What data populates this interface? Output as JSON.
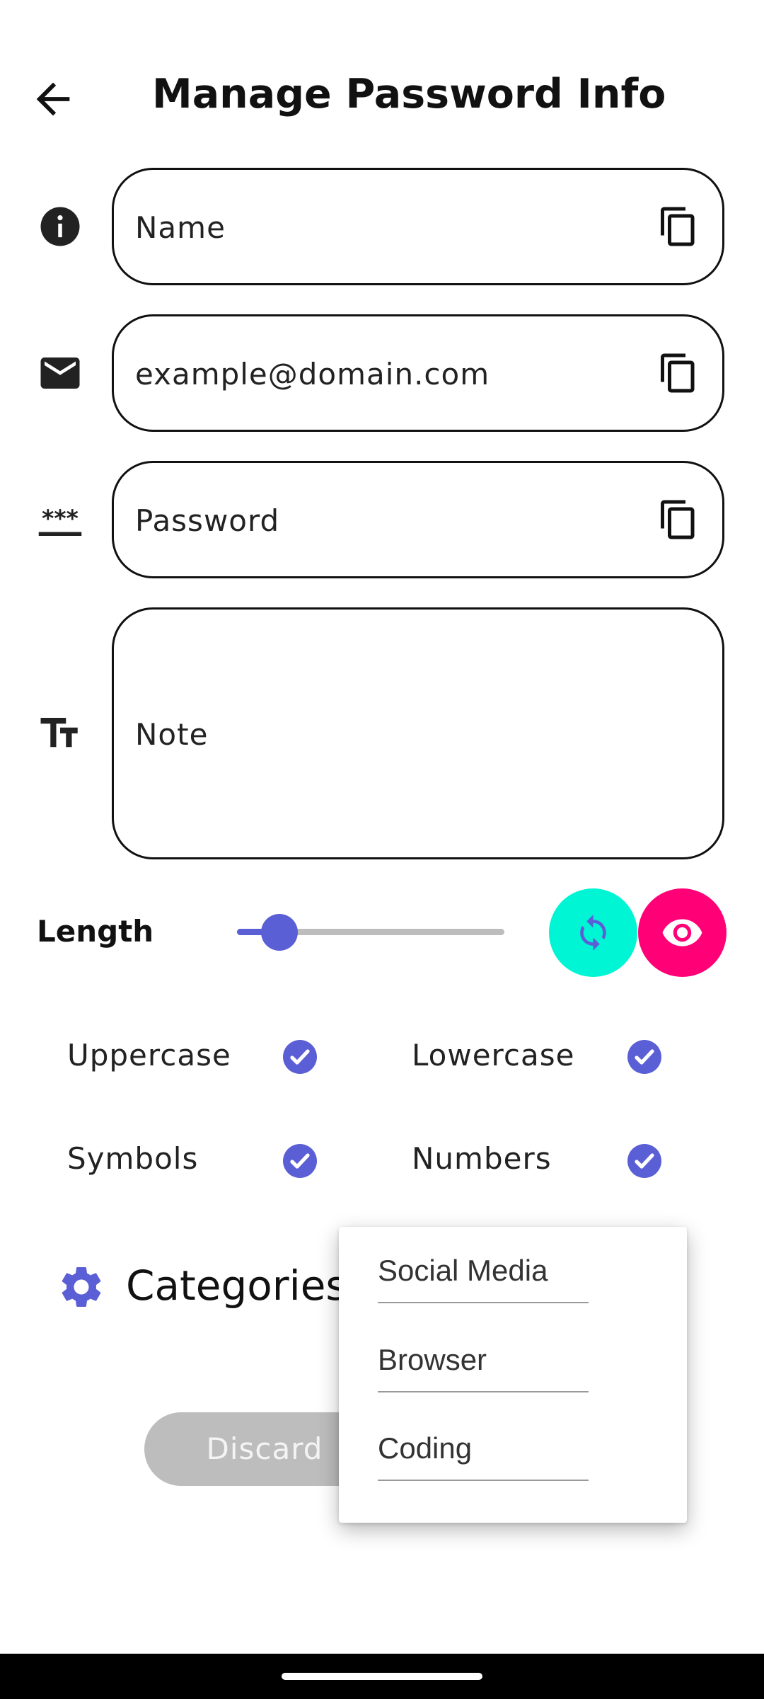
{
  "header": {
    "title": "Manage Password Info",
    "back_icon": "arrow-back-icon"
  },
  "fields": {
    "name": {
      "placeholder": "Name",
      "icon": "info-icon",
      "action_icon": "copy-icon"
    },
    "email": {
      "placeholder": "example@domain.com",
      "icon": "mail-icon",
      "action_icon": "copy-icon"
    },
    "password": {
      "placeholder": "Password",
      "icon": "password-icon",
      "action_icon": "copy-icon"
    },
    "note": {
      "placeholder": "Note",
      "icon": "text-size-icon"
    }
  },
  "generator": {
    "length_label": "Length",
    "length_slider_fraction": 0.16,
    "refresh_icon": "refresh-icon",
    "visibility_icon": "eye-icon",
    "options": [
      {
        "label": "Uppercase",
        "checked": true
      },
      {
        "label": "Lowercase",
        "checked": true
      },
      {
        "label": "Symbols",
        "checked": true
      },
      {
        "label": "Numbers",
        "checked": true
      }
    ]
  },
  "categories": {
    "label": "Categories:",
    "icon": "gear-icon",
    "menu": [
      "Social Media",
      "Browser",
      "Coding"
    ]
  },
  "actions": {
    "discard_label": "Discard"
  },
  "colors": {
    "accent": "#5b5fd6",
    "refresh_button": "#00f5d4",
    "visibility_button": "#ff0077",
    "disabled_button": "#bdbdbd"
  }
}
